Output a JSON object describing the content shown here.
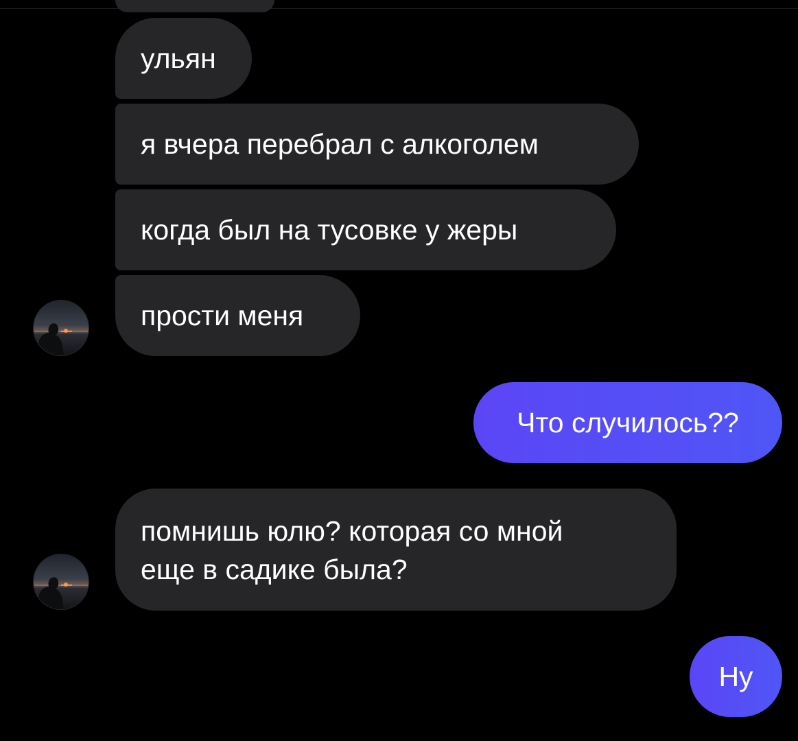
{
  "chat": {
    "messages": [
      {
        "id": "m1",
        "direction": "incoming",
        "text": "ульян"
      },
      {
        "id": "m2",
        "direction": "incoming",
        "text": "я вчера перебрал с алкоголем"
      },
      {
        "id": "m3",
        "direction": "incoming",
        "text": "когда был на тусовке у жеры"
      },
      {
        "id": "m4",
        "direction": "incoming",
        "text": "прости меня"
      },
      {
        "id": "m5",
        "direction": "outgoing",
        "text": "Что случилось??"
      },
      {
        "id": "m6",
        "direction": "incoming",
        "lines": [
          "помнишь юлю? которая со мной",
          "еще в садике была?"
        ]
      },
      {
        "id": "m7",
        "direction": "outgoing",
        "text": "Ну"
      }
    ],
    "contact_avatar": "sunset-silhouette-avatar"
  },
  "colors": {
    "background": "#000000",
    "incoming_bubble": "#262628",
    "outgoing_bubble": "#5b46f6",
    "text": "#ffffff"
  }
}
